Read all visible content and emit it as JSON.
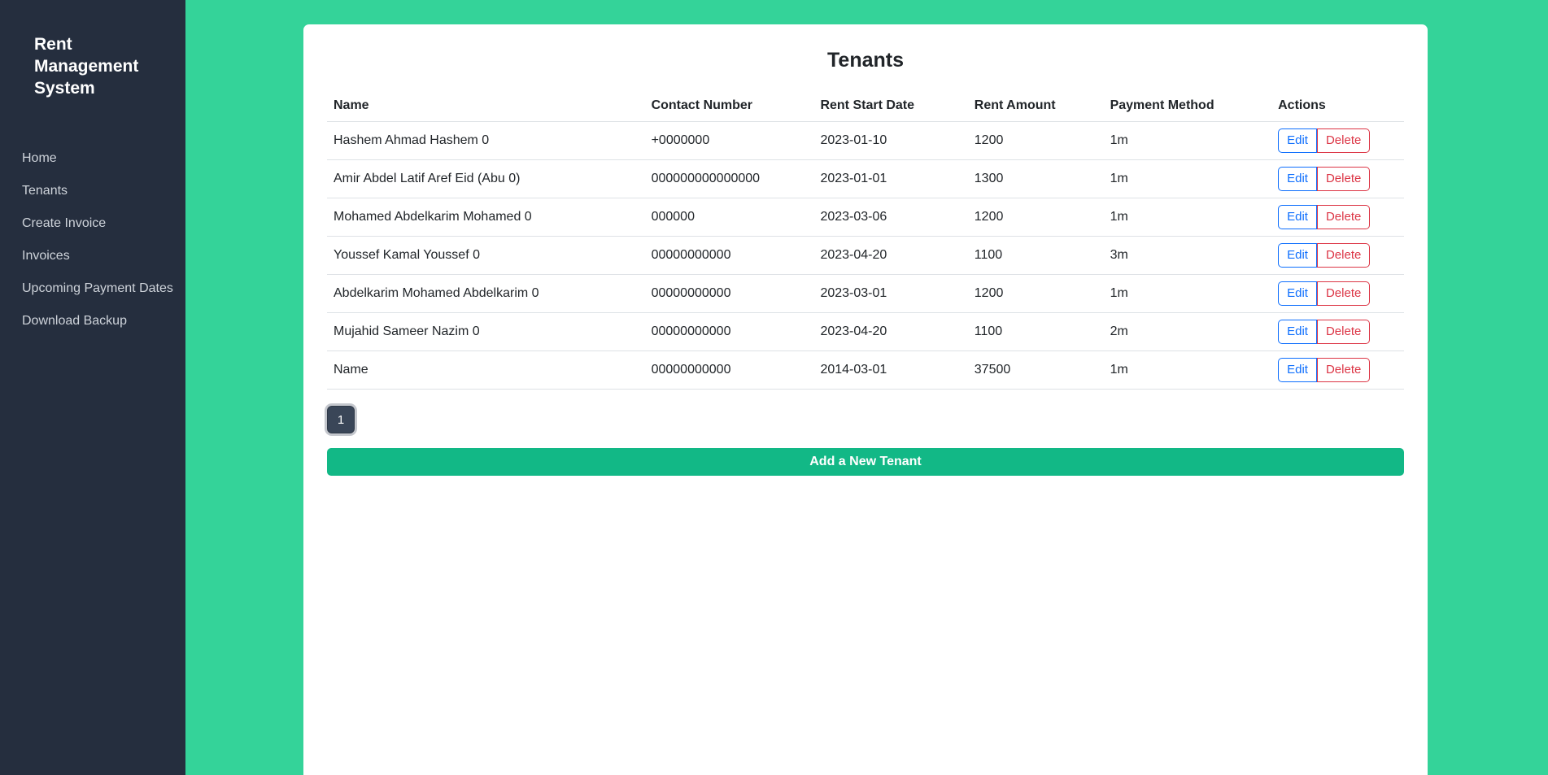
{
  "sidebar": {
    "brand_lines": [
      "Rent",
      "Management",
      "System"
    ],
    "items": [
      {
        "label": "Home"
      },
      {
        "label": "Tenants"
      },
      {
        "label": "Create Invoice"
      },
      {
        "label": "Invoices"
      },
      {
        "label": "Upcoming Payment Dates"
      },
      {
        "label": "Download Backup"
      }
    ]
  },
  "main": {
    "title": "Tenants",
    "table": {
      "headers": [
        "Name",
        "Contact Number",
        "Rent Start Date",
        "Rent Amount",
        "Payment Method",
        "Actions"
      ],
      "rows": [
        {
          "name": "Hashem Ahmad Hashem 0",
          "contact": "+0000000",
          "start_date": "2023-01-10",
          "amount": "1200",
          "method": "1m"
        },
        {
          "name": "Amir Abdel Latif Aref Eid (Abu 0)",
          "contact": "000000000000000",
          "start_date": "2023-01-01",
          "amount": "1300",
          "method": "1m"
        },
        {
          "name": "Mohamed Abdelkarim Mohamed 0",
          "contact": "000000",
          "start_date": "2023-03-06",
          "amount": "1200",
          "method": "1m"
        },
        {
          "name": "Youssef Kamal Youssef 0",
          "contact": "00000000000",
          "start_date": "2023-04-20",
          "amount": "1100",
          "method": "3m"
        },
        {
          "name": "Abdelkarim Mohamed Abdelkarim 0",
          "contact": "00000000000",
          "start_date": "2023-03-01",
          "amount": "1200",
          "method": "1m"
        },
        {
          "name": "Mujahid Sameer Nazim 0",
          "contact": "00000000000",
          "start_date": "2023-04-20",
          "amount": "1100",
          "method": "2m"
        },
        {
          "name": "Name",
          "contact": "00000000000",
          "start_date": "2014-03-01",
          "amount": "37500",
          "method": "1m"
        }
      ],
      "edit_label": "Edit",
      "delete_label": "Delete"
    },
    "pagination": {
      "current_page": "1"
    },
    "add_tenant_label": "Add a New Tenant"
  },
  "colors": {
    "page_background": "#34d399",
    "sidebar_background": "#252e3e",
    "add_button_green": "#12b886",
    "pagination_dark": "#3a4658",
    "edit_accent": "#0d6efd",
    "delete_accent": "#dc3545",
    "row_divider": "#dee2e6"
  }
}
